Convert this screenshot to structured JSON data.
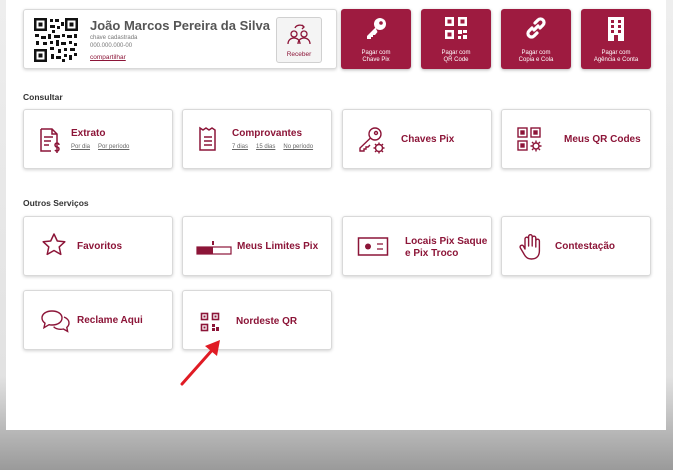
{
  "colors": {
    "accent": "#9e1b40",
    "arrow": "#e01b24"
  },
  "profile": {
    "name": "João Marcos Pereira da Silva",
    "key_label": "chave cadastrada",
    "key_value": "000.000.000-00",
    "share_label": "compartilhar",
    "receive_label": "Receber"
  },
  "pay_buttons": [
    {
      "line1": "Pagar com",
      "line2": "Chave Pix",
      "icon": "key-icon"
    },
    {
      "line1": "Pagar com",
      "line2": "QR Code",
      "icon": "qr-code-icon"
    },
    {
      "line1": "Pagar com",
      "line2": "Copia e Cola",
      "icon": "link-icon"
    },
    {
      "line1": "Pagar com",
      "line2": "Agência e Conta",
      "icon": "building-icon"
    }
  ],
  "consultar": {
    "title": "Consultar",
    "tiles": [
      {
        "label": "Extrato",
        "icon": "statement-dollar-icon",
        "links": [
          "Por dia",
          "Por período"
        ]
      },
      {
        "label": "Comprovantes",
        "icon": "receipt-icon",
        "links": [
          "7 dias",
          "15 dias",
          "No período"
        ]
      },
      {
        "label": "Chaves Pix",
        "icon": "key-gear-icon"
      },
      {
        "label": "Meus QR Codes",
        "icon": "qr-gear-icon"
      }
    ]
  },
  "outros": {
    "title": "Outros Serviços",
    "tiles": [
      {
        "label": "Favoritos",
        "icon": "star-icon"
      },
      {
        "label": "Meus Limites Pix",
        "icon": "limit-slider-icon"
      },
      {
        "label": "Locais Pix Saque",
        "label2": "e Pix Troco",
        "icon": "cash-bill-icon"
      },
      {
        "label": "Contestação",
        "icon": "hand-icon"
      },
      {
        "label": "Reclame Aqui",
        "icon": "speech-bubbles-icon"
      },
      {
        "label": "Nordeste QR",
        "icon": "qr-small-icon"
      }
    ]
  }
}
